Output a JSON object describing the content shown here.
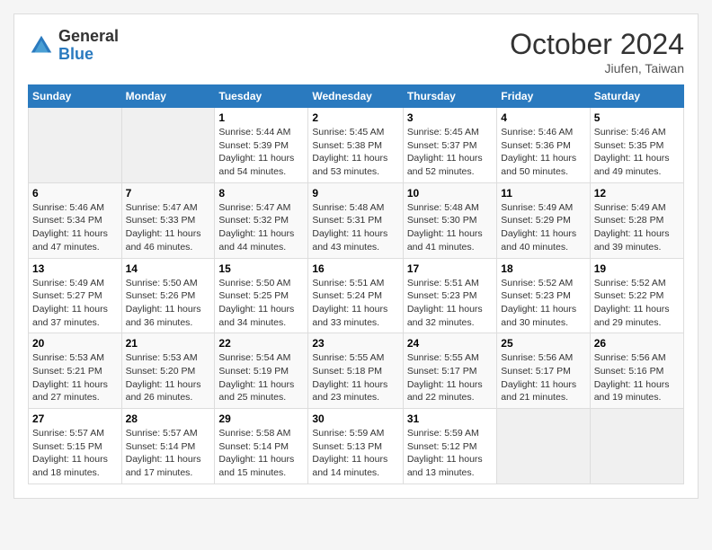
{
  "header": {
    "logo_line1": "General",
    "logo_line2": "Blue",
    "month_title": "October 2024",
    "location": "Jiufen, Taiwan"
  },
  "weekdays": [
    "Sunday",
    "Monday",
    "Tuesday",
    "Wednesday",
    "Thursday",
    "Friday",
    "Saturday"
  ],
  "weeks": [
    [
      {
        "day": "",
        "info": ""
      },
      {
        "day": "",
        "info": ""
      },
      {
        "day": "1",
        "info": "Sunrise: 5:44 AM\nSunset: 5:39 PM\nDaylight: 11 hours and 54 minutes."
      },
      {
        "day": "2",
        "info": "Sunrise: 5:45 AM\nSunset: 5:38 PM\nDaylight: 11 hours and 53 minutes."
      },
      {
        "day": "3",
        "info": "Sunrise: 5:45 AM\nSunset: 5:37 PM\nDaylight: 11 hours and 52 minutes."
      },
      {
        "day": "4",
        "info": "Sunrise: 5:46 AM\nSunset: 5:36 PM\nDaylight: 11 hours and 50 minutes."
      },
      {
        "day": "5",
        "info": "Sunrise: 5:46 AM\nSunset: 5:35 PM\nDaylight: 11 hours and 49 minutes."
      }
    ],
    [
      {
        "day": "6",
        "info": "Sunrise: 5:46 AM\nSunset: 5:34 PM\nDaylight: 11 hours and 47 minutes."
      },
      {
        "day": "7",
        "info": "Sunrise: 5:47 AM\nSunset: 5:33 PM\nDaylight: 11 hours and 46 minutes."
      },
      {
        "day": "8",
        "info": "Sunrise: 5:47 AM\nSunset: 5:32 PM\nDaylight: 11 hours and 44 minutes."
      },
      {
        "day": "9",
        "info": "Sunrise: 5:48 AM\nSunset: 5:31 PM\nDaylight: 11 hours and 43 minutes."
      },
      {
        "day": "10",
        "info": "Sunrise: 5:48 AM\nSunset: 5:30 PM\nDaylight: 11 hours and 41 minutes."
      },
      {
        "day": "11",
        "info": "Sunrise: 5:49 AM\nSunset: 5:29 PM\nDaylight: 11 hours and 40 minutes."
      },
      {
        "day": "12",
        "info": "Sunrise: 5:49 AM\nSunset: 5:28 PM\nDaylight: 11 hours and 39 minutes."
      }
    ],
    [
      {
        "day": "13",
        "info": "Sunrise: 5:49 AM\nSunset: 5:27 PM\nDaylight: 11 hours and 37 minutes."
      },
      {
        "day": "14",
        "info": "Sunrise: 5:50 AM\nSunset: 5:26 PM\nDaylight: 11 hours and 36 minutes."
      },
      {
        "day": "15",
        "info": "Sunrise: 5:50 AM\nSunset: 5:25 PM\nDaylight: 11 hours and 34 minutes."
      },
      {
        "day": "16",
        "info": "Sunrise: 5:51 AM\nSunset: 5:24 PM\nDaylight: 11 hours and 33 minutes."
      },
      {
        "day": "17",
        "info": "Sunrise: 5:51 AM\nSunset: 5:23 PM\nDaylight: 11 hours and 32 minutes."
      },
      {
        "day": "18",
        "info": "Sunrise: 5:52 AM\nSunset: 5:23 PM\nDaylight: 11 hours and 30 minutes."
      },
      {
        "day": "19",
        "info": "Sunrise: 5:52 AM\nSunset: 5:22 PM\nDaylight: 11 hours and 29 minutes."
      }
    ],
    [
      {
        "day": "20",
        "info": "Sunrise: 5:53 AM\nSunset: 5:21 PM\nDaylight: 11 hours and 27 minutes."
      },
      {
        "day": "21",
        "info": "Sunrise: 5:53 AM\nSunset: 5:20 PM\nDaylight: 11 hours and 26 minutes."
      },
      {
        "day": "22",
        "info": "Sunrise: 5:54 AM\nSunset: 5:19 PM\nDaylight: 11 hours and 25 minutes."
      },
      {
        "day": "23",
        "info": "Sunrise: 5:55 AM\nSunset: 5:18 PM\nDaylight: 11 hours and 23 minutes."
      },
      {
        "day": "24",
        "info": "Sunrise: 5:55 AM\nSunset: 5:17 PM\nDaylight: 11 hours and 22 minutes."
      },
      {
        "day": "25",
        "info": "Sunrise: 5:56 AM\nSunset: 5:17 PM\nDaylight: 11 hours and 21 minutes."
      },
      {
        "day": "26",
        "info": "Sunrise: 5:56 AM\nSunset: 5:16 PM\nDaylight: 11 hours and 19 minutes."
      }
    ],
    [
      {
        "day": "27",
        "info": "Sunrise: 5:57 AM\nSunset: 5:15 PM\nDaylight: 11 hours and 18 minutes."
      },
      {
        "day": "28",
        "info": "Sunrise: 5:57 AM\nSunset: 5:14 PM\nDaylight: 11 hours and 17 minutes."
      },
      {
        "day": "29",
        "info": "Sunrise: 5:58 AM\nSunset: 5:14 PM\nDaylight: 11 hours and 15 minutes."
      },
      {
        "day": "30",
        "info": "Sunrise: 5:59 AM\nSunset: 5:13 PM\nDaylight: 11 hours and 14 minutes."
      },
      {
        "day": "31",
        "info": "Sunrise: 5:59 AM\nSunset: 5:12 PM\nDaylight: 11 hours and 13 minutes."
      },
      {
        "day": "",
        "info": ""
      },
      {
        "day": "",
        "info": ""
      }
    ]
  ]
}
